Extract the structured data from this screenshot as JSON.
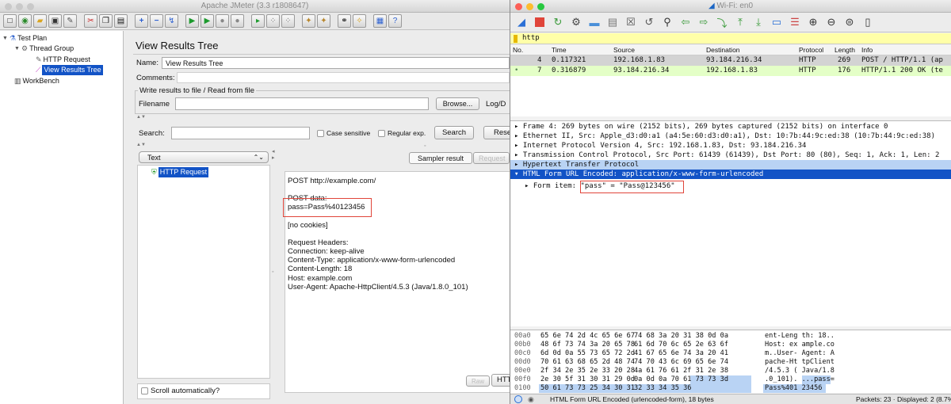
{
  "jmeter": {
    "title": "Apache JMeter (3.3 r1808647)",
    "tree": {
      "test_plan": "Test Plan",
      "thread_group": "Thread Group",
      "http_request": "HTTP Request",
      "view_results_tree": "View Results Tree",
      "workbench": "WorkBench"
    },
    "panel": {
      "title": "View Results Tree",
      "name_label": "Name:",
      "name_value": "View Results Tree",
      "comments_label": "Comments:",
      "file_group": "Write results to file / Read from file",
      "filename_label": "Filename",
      "browse_label": "Browse...",
      "logdisplay_label": "Log/D",
      "search_label": "Search:",
      "case_sensitive": "Case sensitive",
      "regular_exp": "Regular exp.",
      "search_btn": "Search",
      "reset_btn": "Rese",
      "renderer": "Text",
      "result_item": "HTTP Request",
      "tab_sampler": "Sampler result",
      "tab_request": "Request",
      "scroll_auto": "Scroll automatically?",
      "raw_btn": "Raw",
      "http_btn": "HTT"
    },
    "request": {
      "line1": "POST http://example.com/",
      "post_data_label": "POST data:",
      "post_data_value": "pass=Pass%40123456",
      "cookies": "[no cookies]",
      "headers_label": "Request Headers:",
      "h1": "Connection: keep-alive",
      "h2": "Content-Type: application/x-www-form-urlencoded",
      "h3": "Content-Length: 18",
      "h4": "Host: example.com",
      "h5": "User-Agent: Apache-HttpClient/4.5.3 (Java/1.8.0_101)"
    }
  },
  "wireshark": {
    "title": "Wi-Fi: en0",
    "filter": "http",
    "columns": [
      "No.",
      "Time",
      "Source",
      "Destination",
      "Protocol",
      "Length",
      "Info"
    ],
    "packets": [
      {
        "no": "4",
        "time": "0.117321",
        "src": "192.168.1.83",
        "dst": "93.184.216.34",
        "proto": "HTTP",
        "len": "269",
        "info": "POST / HTTP/1.1  (ap"
      },
      {
        "no": "7",
        "time": "0.316879",
        "src": "93.184.216.34",
        "dst": "192.168.1.83",
        "proto": "HTTP",
        "len": "176",
        "info": "HTTP/1.1 200 OK  (te"
      }
    ],
    "details": [
      "Frame 4: 269 bytes on wire (2152 bits), 269 bytes captured (2152 bits) on interface 0",
      "Ethernet II, Src: Apple_d3:d0:a1 (a4:5e:60:d3:d0:a1), Dst: 10:7b:44:9c:ed:38 (10:7b:44:9c:ed:38)",
      "Internet Protocol Version 4, Src: 192.168.1.83, Dst: 93.184.216.34",
      "Transmission Control Protocol, Src Port: 61439 (61439), Dst Port: 80 (80), Seq: 1, Ack: 1, Len: 2",
      "Hypertext Transfer Protocol",
      "HTML Form URL Encoded: application/x-www-form-urlencoded"
    ],
    "form_item_label": "Form item:",
    "form_item_value": "\"pass\" = \"Pass@123456\"",
    "bytes": [
      {
        "off": "00a0",
        "hex1": "65 6e 74 2d 4c 65 6e 67",
        "hex2": "74 68 3a 20 31 38 0d 0a",
        "ascii": "ent-Leng th: 18.."
      },
      {
        "off": "00b0",
        "hex1": "48 6f 73 74 3a 20 65 78",
        "hex2": "61 6d 70 6c 65 2e 63 6f",
        "ascii": "Host: ex ample.co"
      },
      {
        "off": "00c0",
        "hex1": "6d 0d 0a 55 73 65 72 2d",
        "hex2": "41 67 65 6e 74 3a 20 41",
        "ascii": "m..User- Agent: A"
      },
      {
        "off": "00d0",
        "hex1": "70 61 63 68 65 2d 48 74",
        "hex2": "74 70 43 6c 69 65 6e 74",
        "ascii": "pache-Ht tpClient"
      },
      {
        "off": "00e0",
        "hex1": "2f 34 2e 35 2e 33 20 28",
        "hex2": "4a 61 76 61 2f 31 2e 38",
        "ascii": "/4.5.3 ( Java/1.8"
      },
      {
        "off": "00f0",
        "hex1": "2e 30 5f 31 30 31 29 0d",
        "hex2": "0a 0d 0a 70 61 73 73 3d",
        "ascii": ".0_101). ...pass="
      },
      {
        "off": "0100",
        "hex1": "50 61 73 73 25 34 30 31",
        "hex2": "32 33 34 35 36",
        "ascii": "Pass%401 23456"
      }
    ],
    "status_left": "HTML Form URL Encoded (urlencoded-form), 18 bytes",
    "status_right": "Packets: 23 · Displayed: 2 (8.7%"
  }
}
